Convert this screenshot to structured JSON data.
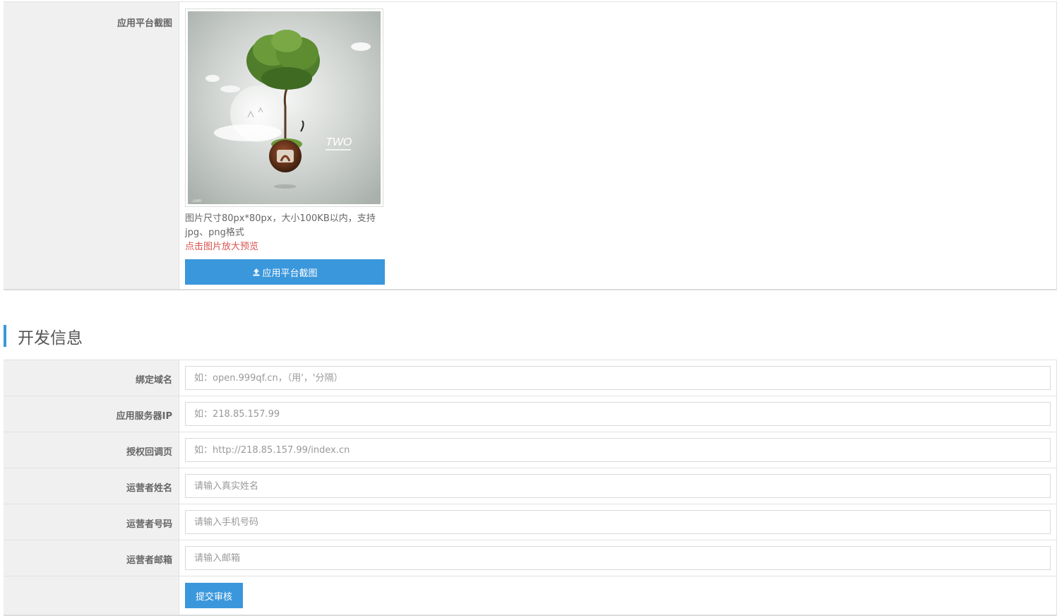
{
  "screenshot_section": {
    "label": "应用平台截图",
    "image_alt": "TWO",
    "hint": "图片尺寸80px*80px，大小100KB以内，支持jpg、png格式",
    "preview_hint": "点击图片放大预览",
    "upload_button": "应用平台截图",
    "upload_icon": "upload-icon"
  },
  "dev_info": {
    "title": "开发信息",
    "accent_color": "#3a97dc",
    "fields": [
      {
        "label": "绑定域名",
        "placeholder": "如：open.999qf.cn，（用'，'分隔）"
      },
      {
        "label": "应用服务器IP",
        "placeholder": "如：218.85.157.99"
      },
      {
        "label": "授权回调页",
        "placeholder": "如：http://218.85.157.99/index.cn"
      },
      {
        "label": "运营者姓名",
        "placeholder": "请输入真实姓名"
      },
      {
        "label": "运营者号码",
        "placeholder": "请输入手机号码"
      },
      {
        "label": "运营者邮箱",
        "placeholder": "请输入邮箱"
      }
    ],
    "submit_button": "提交审核"
  }
}
